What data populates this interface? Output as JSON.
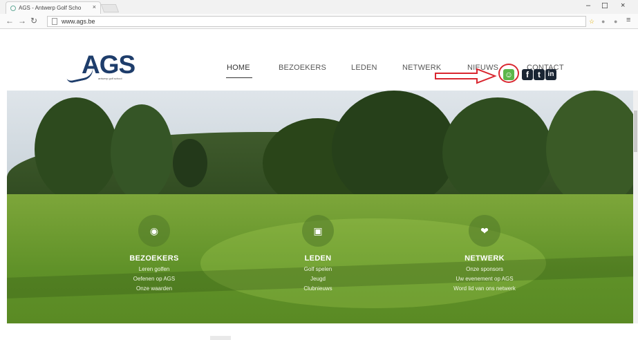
{
  "browser": {
    "tab_title": "AGS - Antwerp Golf Scho",
    "tab_close": "×",
    "url": "www.ags.be",
    "window_controls": [
      "–",
      "☐",
      "×"
    ],
    "nav_icons": [
      "back-icon",
      "forward-icon",
      "reload-icon"
    ]
  },
  "site": {
    "logo_text": "AGS",
    "logo_tagline": "antwerp golf school",
    "nav": [
      {
        "label": "HOME"
      },
      {
        "label": "BEZOEKERS"
      },
      {
        "label": "LEDEN"
      },
      {
        "label": "NETWERK"
      },
      {
        "label": "NIEUWS"
      },
      {
        "label": "CONTACT"
      }
    ],
    "active_nav": "HOME",
    "social": [
      {
        "icon": "agent-icon",
        "glyph": "☺"
      },
      {
        "icon": "facebook-icon",
        "glyph": "f"
      },
      {
        "icon": "twitter-icon",
        "glyph": "t"
      },
      {
        "icon": "linkedin-icon",
        "glyph": "in"
      }
    ],
    "annotation_color": "#d9262f"
  },
  "hero": {
    "columns": [
      {
        "icon": "eye-icon",
        "glyph": "◉",
        "title": "BEZOEKERS",
        "links": [
          "Leren golfen",
          "Oefenen op AGS",
          "Onze waarden"
        ]
      },
      {
        "icon": "member-card-icon",
        "glyph": "▣",
        "title": "LEDEN",
        "links": [
          "Golf spelen",
          "Jeugd",
          "Clubnieuws"
        ]
      },
      {
        "icon": "handshake-icon",
        "glyph": "❤",
        "title": "NETWERK",
        "links": [
          "Onze sponsors",
          "Uw evenement op AGS",
          "Word lid van ons netwerk"
        ]
      }
    ]
  }
}
